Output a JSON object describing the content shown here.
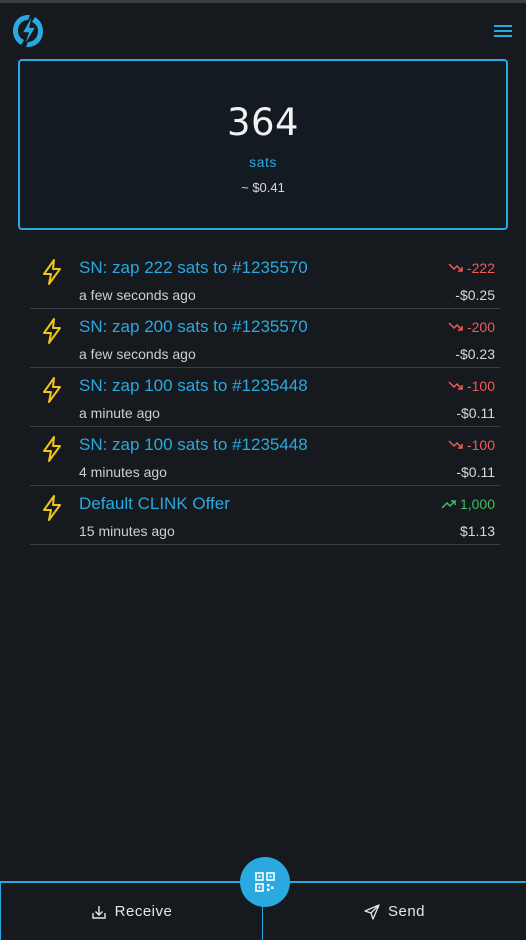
{
  "header": {
    "logo_icon": "lightning-logo-icon",
    "menu_icon": "hamburger-menu-icon"
  },
  "balance": {
    "amount": "364",
    "unit": "sats",
    "fiat": "~ $0.41"
  },
  "transactions": [
    {
      "title": "SN: zap 222 sats to #1235570",
      "time": "a few seconds ago",
      "amount": "-222",
      "fiat": "-$0.25",
      "direction": "out"
    },
    {
      "title": "SN: zap 200 sats to #1235570",
      "time": "a few seconds ago",
      "amount": "-200",
      "fiat": "-$0.23",
      "direction": "out"
    },
    {
      "title": "SN: zap 100 sats to #1235448",
      "time": "a minute ago",
      "amount": "-100",
      "fiat": "-$0.11",
      "direction": "out"
    },
    {
      "title": "SN: zap 100 sats to #1235448",
      "time": "4 minutes ago",
      "amount": "-100",
      "fiat": "-$0.11",
      "direction": "out"
    },
    {
      "title": "Default CLINK Offer",
      "time": "15 minutes ago",
      "amount": "1,000",
      "fiat": "$1.13",
      "direction": "in"
    }
  ],
  "bottom_nav": {
    "receive_label": "Receive",
    "send_label": "Send",
    "scan_icon": "qr-code-icon"
  },
  "colors": {
    "accent": "#2aa9e0",
    "negative": "#ef5a5a",
    "positive": "#3fbf5f",
    "lightning": "#f0c419"
  }
}
